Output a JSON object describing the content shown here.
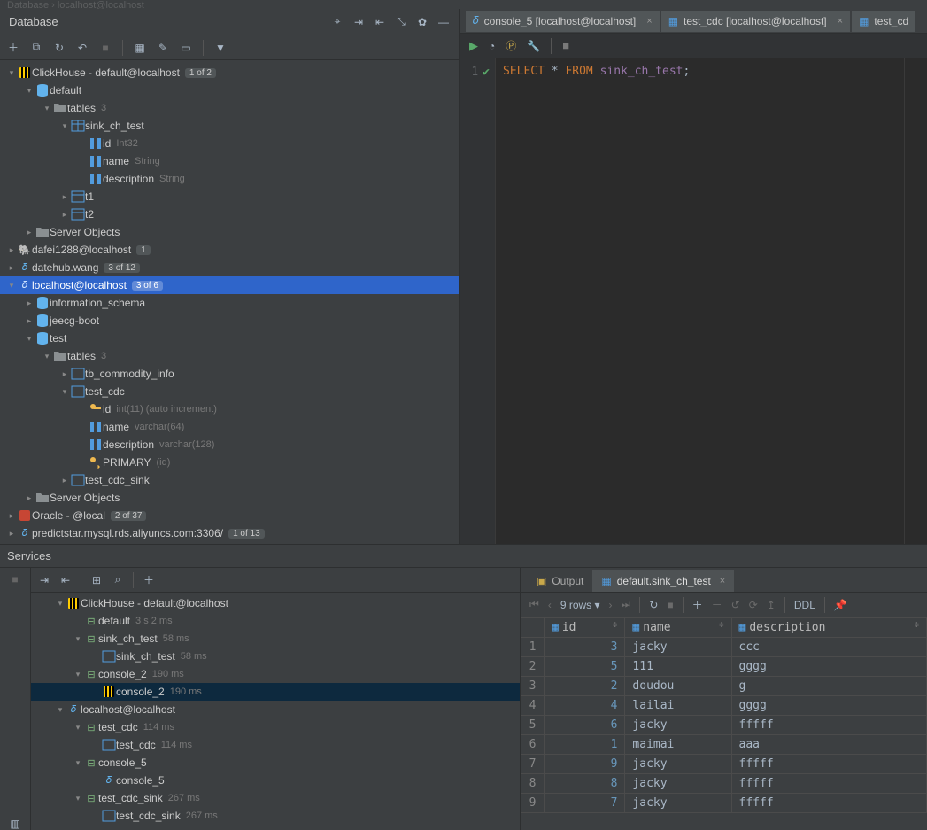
{
  "breadcrumbs": "Database  ›  localhost@localhost",
  "db_panel": {
    "title": "Database"
  },
  "tree": {
    "clickhouse": {
      "name": "ClickHouse - default@localhost",
      "pill": "1 of 2"
    },
    "ch_default": "default",
    "ch_tables": "tables",
    "ch_tables_count": "3",
    "sink_ch_test": "sink_ch_test",
    "sink_cols": [
      {
        "n": "id",
        "t": "Int32"
      },
      {
        "n": "name",
        "t": "String"
      },
      {
        "n": "description",
        "t": "String"
      }
    ],
    "t1": "t1",
    "t2": "t2",
    "server_objects": "Server Objects",
    "dafei": {
      "n": "dafei1288@localhost",
      "pill": "1"
    },
    "datehub": {
      "n": "datehub.wang",
      "pill": "3 of 12"
    },
    "localhost": {
      "n": "localhost@localhost",
      "pill": "3 of 6"
    },
    "info_schema": "information_schema",
    "jeecg": "jeecg-boot",
    "test": "test",
    "test_tables": "tables",
    "test_tables_count": "3",
    "tb_commodity": "tb_commodity_info",
    "test_cdc": "test_cdc",
    "cdc_cols": [
      {
        "n": "id",
        "t": "int(11) (auto increment)",
        "key": true
      },
      {
        "n": "name",
        "t": "varchar(64)"
      },
      {
        "n": "description",
        "t": "varchar(128)"
      }
    ],
    "primary": {
      "n": "PRIMARY",
      "t": "(id)"
    },
    "test_cdc_sink": "test_cdc_sink",
    "server_objects2": "Server Objects",
    "oracle": {
      "n": "Oracle - @local",
      "pill": "2 of 37"
    },
    "predict": {
      "n": "predictstar.mysql.rds.aliyuncs.com:3306/",
      "pill": "1 of 13"
    }
  },
  "tabs": [
    {
      "n": "console_5 [localhost@localhost]",
      "active": false,
      "icon": "mysql"
    },
    {
      "n": "test_cdc [localhost@localhost]",
      "active": false,
      "icon": "table"
    },
    {
      "n": "test_cd",
      "active": false,
      "icon": "table",
      "cut": true
    }
  ],
  "sql": {
    "line": "1",
    "kw1": "SELECT",
    "star": "*",
    "kw2": "FROM",
    "ident": "sink_ch_test",
    "semi": ";"
  },
  "services_title": "Services",
  "svtree": {
    "clickhouse": "ClickHouse - default@localhost",
    "default": {
      "n": "default",
      "t": "3 s 2 ms"
    },
    "sink_ch_test": {
      "n": "sink_ch_test",
      "t": "58 ms"
    },
    "sink_ch_test2": {
      "n": "sink_ch_test",
      "t": "58 ms"
    },
    "console2": {
      "n": "console_2",
      "t": "190 ms"
    },
    "console2b": {
      "n": "console_2",
      "t": "190 ms"
    },
    "localhost": "localhost@localhost",
    "test_cdc": {
      "n": "test_cdc",
      "t": "114 ms"
    },
    "test_cdc2": {
      "n": "test_cdc",
      "t": "114 ms"
    },
    "console5": {
      "n": "console_5"
    },
    "console5b": {
      "n": "console_5"
    },
    "test_cdc_sink": {
      "n": "test_cdc_sink",
      "t": "267 ms"
    },
    "test_cdc_sink2": {
      "n": "test_cdc_sink",
      "t": "267 ms"
    }
  },
  "output_tabs": {
    "output": "Output",
    "result": "default.sink_ch_test"
  },
  "grid": {
    "rows_label": "9 rows",
    "ddl": "DDL",
    "headers": [
      "id",
      "name",
      "description"
    ],
    "data": [
      {
        "id": 3,
        "name": "jacky",
        "description": "ccc"
      },
      {
        "id": 5,
        "name": "111",
        "description": "gggg"
      },
      {
        "id": 2,
        "name": "doudou",
        "description": "g"
      },
      {
        "id": 4,
        "name": "lailai",
        "description": "gggg"
      },
      {
        "id": 6,
        "name": "jacky",
        "description": "fffff"
      },
      {
        "id": 1,
        "name": "maimai",
        "description": "aaa"
      },
      {
        "id": 9,
        "name": "jacky",
        "description": "fffff"
      },
      {
        "id": 8,
        "name": "jacky",
        "description": "fffff"
      },
      {
        "id": 7,
        "name": "jacky",
        "description": "fffff"
      }
    ]
  }
}
